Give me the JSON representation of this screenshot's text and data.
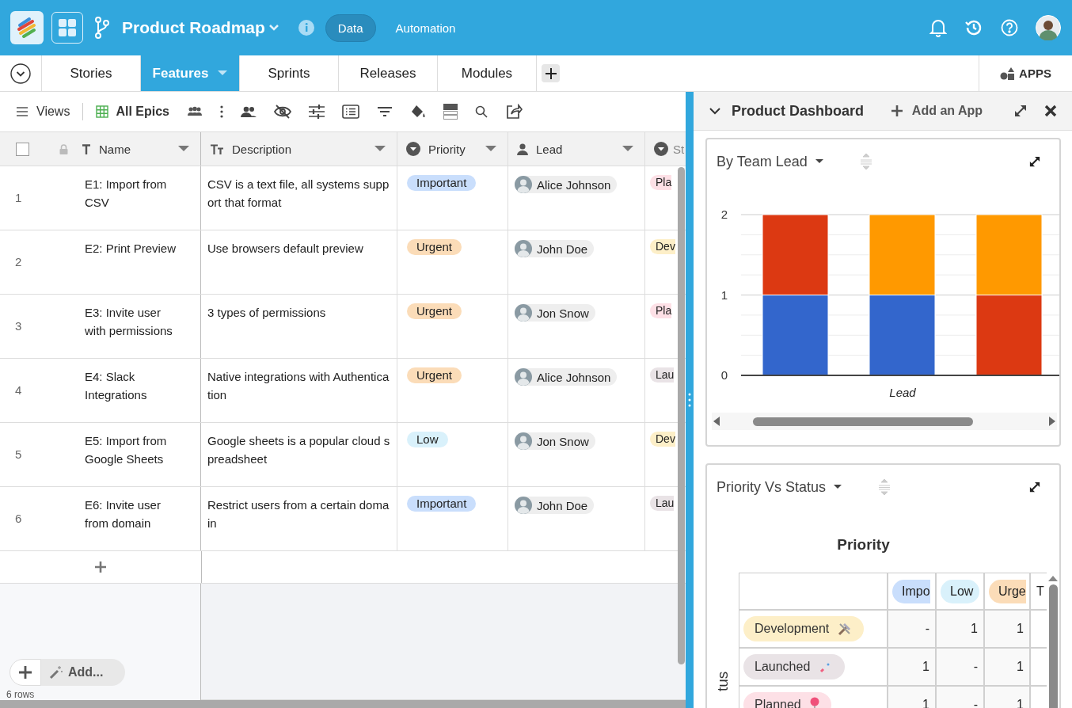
{
  "header": {
    "title": "Product Roadmap",
    "nav": [
      {
        "label": "Data",
        "selected": true
      },
      {
        "label": "Automation",
        "selected": false
      }
    ]
  },
  "tabs": [
    {
      "label": "Stories",
      "selected": false
    },
    {
      "label": "Features",
      "selected": true
    },
    {
      "label": "Sprints",
      "selected": false
    },
    {
      "label": "Releases",
      "selected": false
    },
    {
      "label": "Modules",
      "selected": false
    }
  ],
  "apps_button": "APPS",
  "toolbar": {
    "views": "Views",
    "view_name": "All Epics"
  },
  "table": {
    "select_all": {
      "checked": false
    },
    "columns": [
      "Name",
      "Description",
      "Priority",
      "Lead",
      "St"
    ],
    "rows": [
      {
        "number": "1",
        "name": "E1: Import from CSV",
        "description": "CSV is a text file, all systems support that format",
        "priority": {
          "label": "Important",
          "color": "#c9defc"
        },
        "lead": "Alice Johnson",
        "status": {
          "label": "Pla",
          "color": "#fde0e6"
        }
      },
      {
        "number": "2",
        "name": "E2: Print Preview",
        "description": "Use browsers default preview",
        "priority": {
          "label": "Urgent",
          "color": "#fbdcb8"
        },
        "lead": "John Doe",
        "status": {
          "label": "Dev",
          "color": "#fdefc8"
        }
      },
      {
        "number": "3",
        "name": "E3: Invite user with permissions",
        "description": "3 types of permissions",
        "priority": {
          "label": "Urgent",
          "color": "#fbdcb8"
        },
        "lead": "Jon Snow",
        "status": {
          "label": "Pla",
          "color": "#fde0e6"
        }
      },
      {
        "number": "4",
        "name": "E4: Slack Integrations",
        "description": "Native integrations with Authentication",
        "priority": {
          "label": "Urgent",
          "color": "#fbdcb8"
        },
        "lead": "Alice Johnson",
        "status": {
          "label": "Lau",
          "color": "#e9e3e6"
        }
      },
      {
        "number": "5",
        "name": "E5: Import from Google Sheets",
        "description": "Google sheets is a popular cloud spreadsheet",
        "priority": {
          "label": "Low",
          "color": "#d9f1fb"
        },
        "lead": "Jon Snow",
        "status": {
          "label": "Dev",
          "color": "#fdefc8"
        }
      },
      {
        "number": "6",
        "name": "E6: Invite user from domain",
        "description": "Restrict users from a certain domain",
        "priority": {
          "label": "Important",
          "color": "#c9defc"
        },
        "lead": "John Doe",
        "status": {
          "label": "Lau",
          "color": "#e9e3e6"
        }
      }
    ],
    "add_label": "Add...",
    "row_count": "6 rows"
  },
  "dashboard": {
    "title": "Product Dashboard",
    "add_app": "Add an App",
    "widgets": [
      {
        "kind": "chart",
        "title": "By Team Lead",
        "chart_data": {
          "type": "bar",
          "xlabel": "Lead",
          "stacked": true,
          "ylim": [
            0,
            2
          ],
          "yticks": [
            0,
            1,
            2
          ],
          "series": [
            {
              "color": "#3366cc",
              "values": [
                1,
                1,
                0
              ]
            },
            {
              "color": "#dc3912",
              "values": [
                1,
                0,
                1
              ]
            },
            {
              "color": "#ff9900",
              "values": [
                0,
                1,
                1
              ]
            }
          ]
        }
      },
      {
        "kind": "pivot",
        "title": "Priority Vs Status",
        "column_title": "Priority",
        "row_title": "tus",
        "columns": [
          {
            "label": "Impo",
            "color": "#c9defc"
          },
          {
            "label": "Low",
            "color": "#d9f1fb"
          },
          {
            "label": "Urge",
            "color": "#fbdcb8"
          },
          {
            "label": "T"
          }
        ],
        "rows": [
          {
            "label": "Development",
            "color": "#fdefc8",
            "cells": [
              "-",
              "1",
              "1"
            ]
          },
          {
            "label": "Launched",
            "color": "#e9e3e6",
            "cells": [
              "1",
              "-",
              "1"
            ]
          },
          {
            "label": "Planned",
            "color": "#fde0e6",
            "cells": [
              "1",
              "-",
              "1"
            ]
          }
        ]
      }
    ]
  }
}
